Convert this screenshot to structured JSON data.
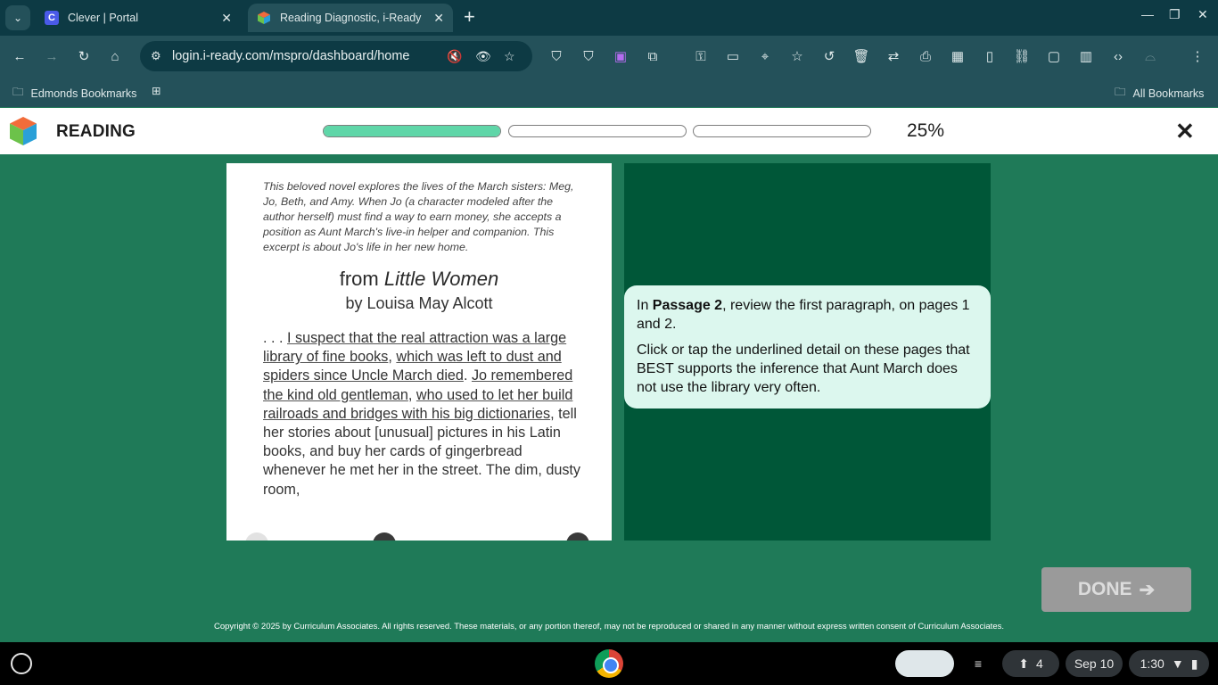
{
  "browser": {
    "tabs": [
      {
        "title": "Clever | Portal",
        "favicon": "C"
      },
      {
        "title": "Reading Diagnostic, i-Ready",
        "favicon": ""
      }
    ],
    "url": "login.i-ready.com/mspro/dashboard/home",
    "bookmarks": {
      "left": "Edmonds Bookmarks",
      "right": "All Bookmarks"
    }
  },
  "app": {
    "title": "READING",
    "progress_percent": "25%",
    "progress_segments": [
      1,
      0,
      0
    ]
  },
  "passage": {
    "intro": "This beloved novel explores the lives of the March sisters: Meg, Jo, Beth, and Amy. When Jo (a character modeled after the author herself) must find a way to earn money, she accepts a position as Aunt March's live-in helper and companion. This excerpt is about Jo's life in her new home.",
    "title_prefix": "from ",
    "title_book": "Little Women",
    "author": "by Louisa May Alcott",
    "body": {
      "lead": ". . . ",
      "d1": "I suspect that the real attraction was a large library of fine books",
      "sep1": ", ",
      "d2": "which was left to dust and spiders since Uncle March died",
      "sep2": ". ",
      "d3": "Jo remembered the kind old gentleman",
      "sep3": ", ",
      "d4": "who used to let her build railroads and bridges with his big dictionaries",
      "rest": ", tell her stories about [unusual] pictures in his Latin books, and buy her cards of gingerbread whenever he met her in the street. The dim, dusty room,"
    }
  },
  "question": {
    "p1_pre": "In ",
    "p1_bold": "Passage 2",
    "p1_post": ", review the first paragraph, on pages 1 and 2.",
    "p2_pre": "Click or tap the underlined detail on these pages that ",
    "p2_bold": "BEST",
    "p2_post": " supports the inference that Aunt March does not use the library very often."
  },
  "done_label": "DONE",
  "copyright": "Copyright © 2025 by Curriculum Associates. All rights reserved. These materials, or any portion thereof, may not be reproduced or shared in any manner without express written consent of Curriculum Associates.",
  "shelf": {
    "notifications": "4",
    "date": "Sep 10",
    "time": "1:30"
  }
}
